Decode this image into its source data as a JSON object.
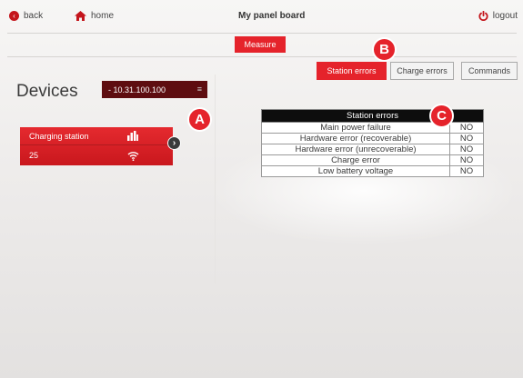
{
  "topbar": {
    "back_label": "back",
    "home_label": "home",
    "board_title": "My panel board",
    "logout_label": "logout"
  },
  "measure_label": "Measure",
  "devices": {
    "title": "Devices",
    "selected_device": "- 10.31.100.100"
  },
  "station_card": {
    "name": "Charging station",
    "value": "25"
  },
  "tabs": [
    {
      "label": "Station errors",
      "active": true
    },
    {
      "label": "Charge errors",
      "active": false
    },
    {
      "label": "Commands",
      "active": false
    }
  ],
  "badges": {
    "a": "A",
    "b": "B",
    "c": "C"
  },
  "station_errors": {
    "title": "Station errors",
    "rows": [
      {
        "label": "Main power failure",
        "value": "NO"
      },
      {
        "label": "Hardware error (recoverable)",
        "value": "NO"
      },
      {
        "label": "Hardware error (unrecoverable)",
        "value": "NO"
      },
      {
        "label": "Charge error",
        "value": "NO"
      },
      {
        "label": "Low battery voltage",
        "value": "NO"
      }
    ]
  },
  "colors": {
    "accent": "#e5232b",
    "dark_select": "#5e0d10"
  }
}
